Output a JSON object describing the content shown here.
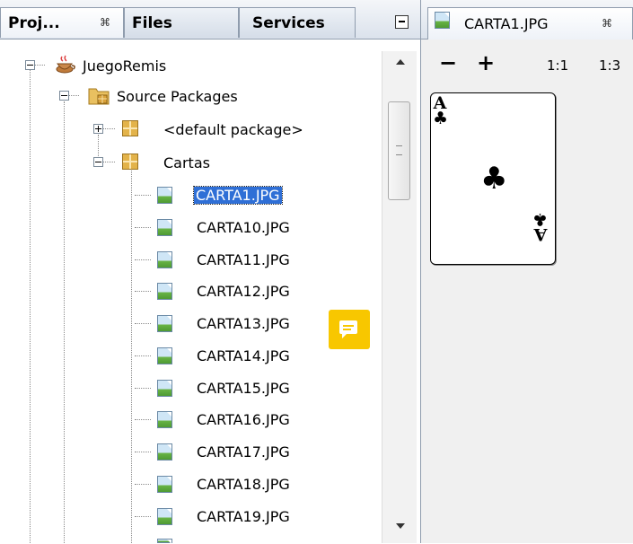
{
  "left_panel": {
    "tabs": [
      {
        "label": "Proj...",
        "close": "⌘"
      },
      {
        "label": "Files"
      },
      {
        "label": "Services"
      }
    ],
    "tree": {
      "project": "JuegoRemis",
      "source_packages": "Source Packages",
      "default_package": "<default package>",
      "package": "Cartas",
      "files": [
        "CARTA1.JPG",
        "CARTA10.JPG",
        "CARTA11.JPG",
        "CARTA12.JPG",
        "CARTA13.JPG",
        "CARTA14.JPG",
        "CARTA15.JPG",
        "CARTA16.JPG",
        "CARTA17.JPG",
        "CARTA18.JPG",
        "CARTA19.JPG"
      ],
      "selected": "CARTA1.JPG"
    }
  },
  "right_panel": {
    "tab": {
      "label": "CARTA1.JPG",
      "close": "⌘"
    },
    "toolbar": {
      "zoom_out": "−",
      "zoom_in": "+",
      "actual_size": "1:1",
      "ratio": "1:3"
    },
    "card": {
      "rank": "A",
      "suit": "♣"
    }
  },
  "icons": [
    "project-icon",
    "package-icon",
    "image-file-icon",
    "comment-icon",
    "minimize-icon"
  ],
  "colors": {
    "selection": "#2f6fd6",
    "comment": "#f8c700"
  }
}
